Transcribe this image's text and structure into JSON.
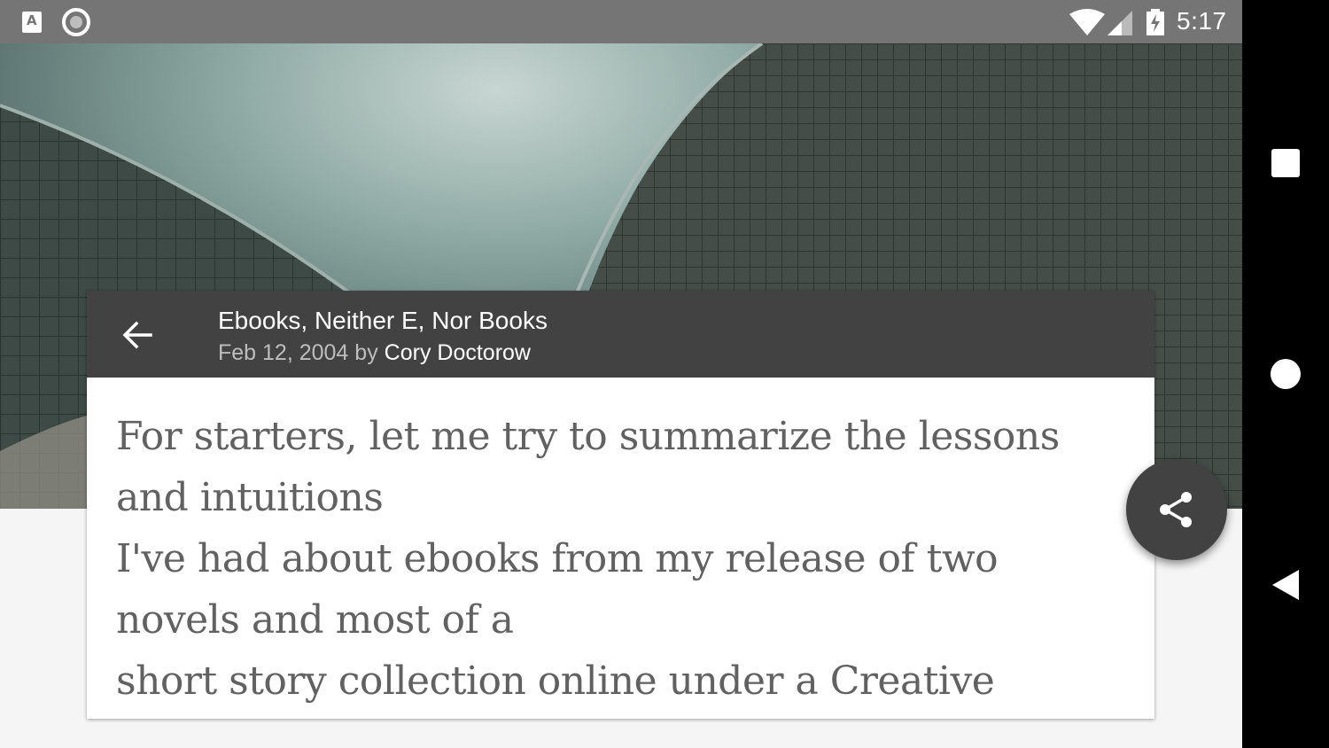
{
  "status_bar": {
    "time": "5:17",
    "icons": [
      "a-notification-icon",
      "circle-notification-icon",
      "wifi-icon",
      "signal-icon",
      "battery-charging-icon"
    ]
  },
  "toolbar": {
    "title": "Ebooks, Neither E, Nor Books",
    "date": "Feb 12, 2004",
    "by": "by",
    "author": "Cory Doctorow",
    "back_icon": "arrow-back-icon"
  },
  "article": {
    "lines": [
      "For starters, let me try to summarize the lessons",
      "and intuitions",
      "I've had about ebooks from my release of two",
      "novels and most of a",
      "short story collection online under a Creative"
    ]
  },
  "fab": {
    "icon": "share-icon"
  },
  "nav_bar": {
    "icons": [
      "recents-icon",
      "home-icon",
      "back-icon"
    ]
  },
  "colors": {
    "status_bar": "#757575",
    "toolbar": "#424242",
    "fab": "#424242",
    "body_text": "#616161"
  }
}
